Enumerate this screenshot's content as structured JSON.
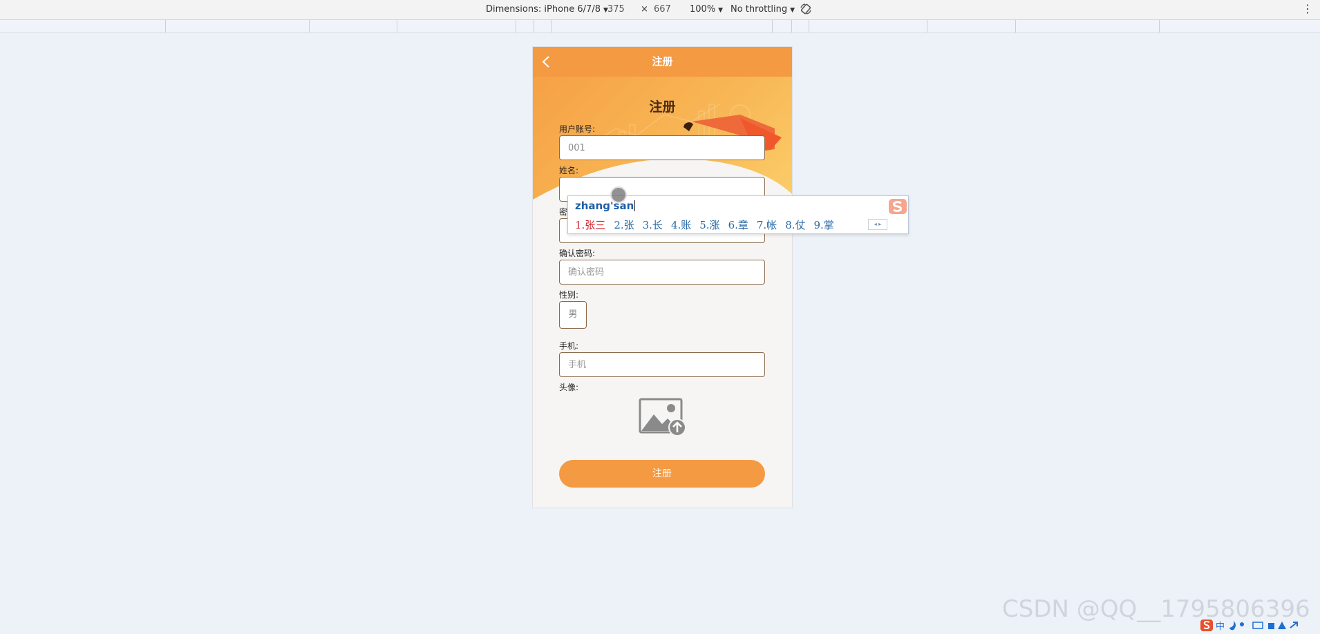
{
  "devtools": {
    "dimensions_label": "Dimensions: iPhone 6/7/8",
    "width": "375",
    "times": "×",
    "height": "667",
    "zoom": "100%",
    "throttling": "No throttling"
  },
  "page": {
    "nav_title": "注册",
    "form_title": "注册",
    "account_label": "用户账号:",
    "account_value": "001",
    "name_label": "姓名:",
    "name_value": "",
    "password_label": "密",
    "password_placeholder": "密码",
    "confirm_label": "确认密码:",
    "confirm_placeholder": "确认密码",
    "gender_label": "性别:",
    "gender_value": "男",
    "phone_label": "手机:",
    "phone_placeholder": "手机",
    "avatar_label": "头像:",
    "submit_label": "注册"
  },
  "ime": {
    "composition": "zhang'san",
    "candidates": [
      "1.张三",
      "2.张",
      "3.长",
      "4.账",
      "5.涨",
      "6.章",
      "7.帐",
      "8.仗",
      "9.掌"
    ]
  },
  "watermark": "CSDN @QQ__1795806396",
  "colors": {
    "accent": "#f39a43",
    "page_bg": "#edf1f8"
  },
  "icons": [
    "back-icon",
    "rotate-icon",
    "image-upload-icon",
    "sogou-icon"
  ]
}
